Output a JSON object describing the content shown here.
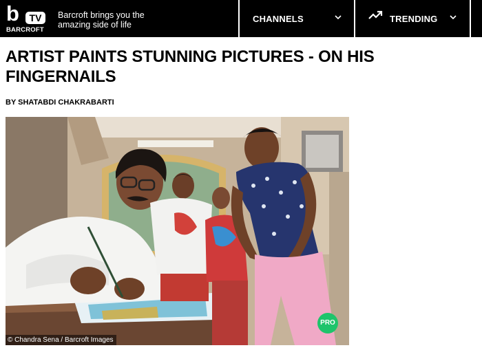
{
  "header": {
    "logo_letter": "b",
    "logo_tv": "TV",
    "logo_name": "BARCROFT",
    "tagline": "Barcroft brings you the amazing side of life",
    "nav": [
      {
        "label": "CHANNELS",
        "icon": "chevron-down-icon"
      },
      {
        "label": "TRENDING",
        "icon": "trending-icon"
      }
    ]
  },
  "article": {
    "headline": "ARTIST PAINTS STUNNING PICTURES - ON HIS FINGERNAILS",
    "byline": "BY SHATABDI CHAKRABARTI"
  },
  "photo": {
    "credit": "© Chandra Sena / Barcroft Images",
    "badge": "PRO"
  },
  "colors": {
    "header_bg": "#000000",
    "badge_green": "#1ec46b",
    "text": "#000000"
  }
}
